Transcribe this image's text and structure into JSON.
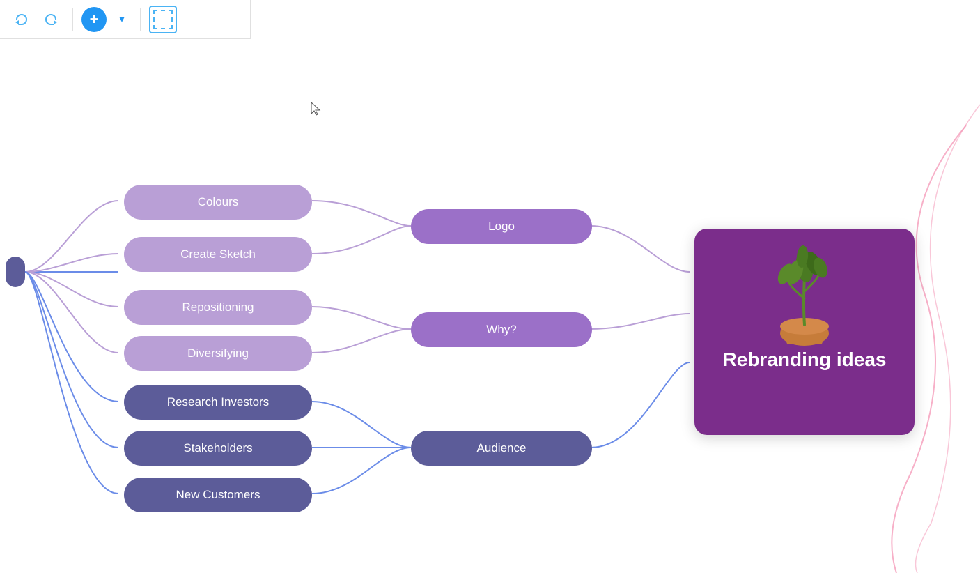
{
  "toolbar": {
    "undo_label": "←",
    "redo_label": "→",
    "add_label": "+",
    "dropdown_label": "▾",
    "select_label": ""
  },
  "mindmap": {
    "center_dot": "",
    "rebranding": {
      "title": "Rebranding ideas"
    },
    "nodes": {
      "logo": {
        "label": "Logo"
      },
      "why": {
        "label": "Why?"
      },
      "audience": {
        "label": "Audience"
      },
      "colours": {
        "label": "Colours"
      },
      "create_sketch": {
        "label": "Create Sketch"
      },
      "repositioning": {
        "label": "Repositioning"
      },
      "diversifying": {
        "label": "Diversifying"
      },
      "research_investors": {
        "label": "Research Investors"
      },
      "stakeholders": {
        "label": "Stakeholders"
      },
      "new_customers": {
        "label": "New Customers"
      }
    }
  }
}
